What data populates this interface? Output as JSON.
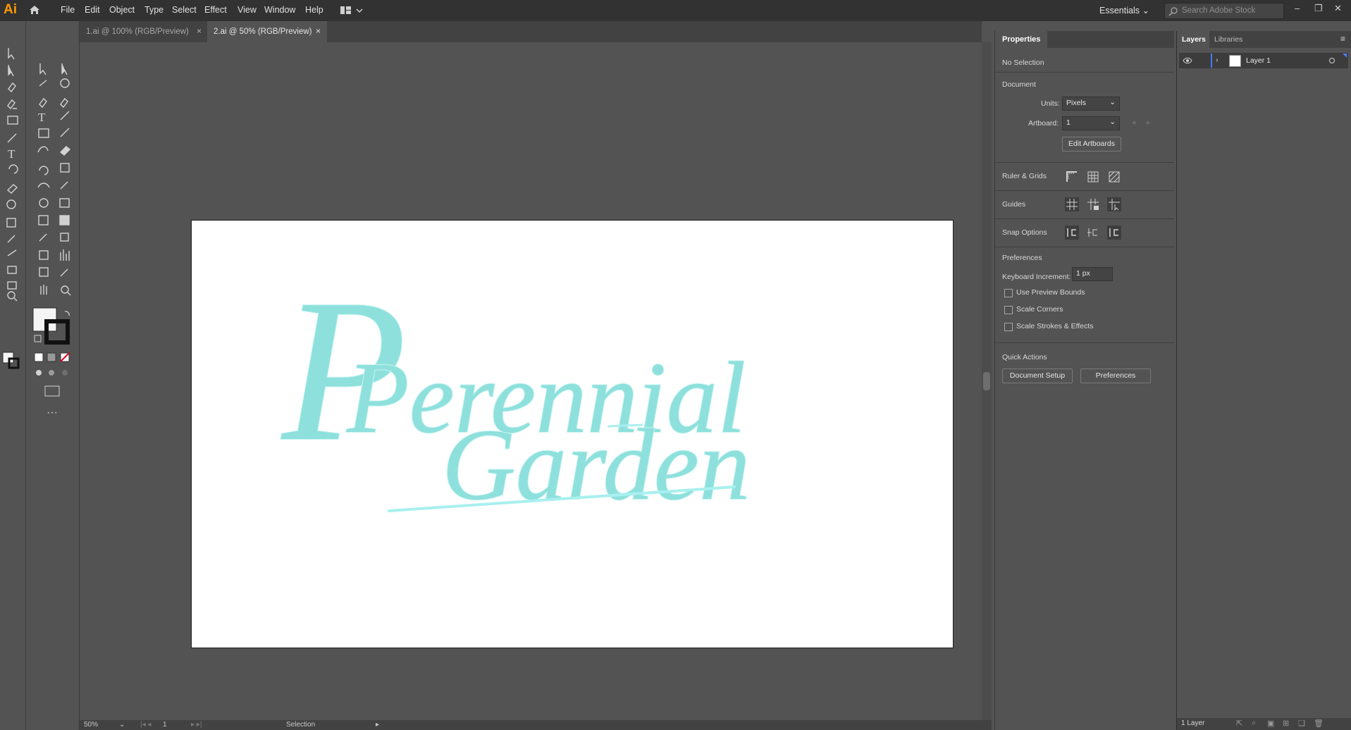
{
  "app": {
    "logo": "Ai"
  },
  "menu": [
    "File",
    "Edit",
    "Object",
    "Type",
    "Select",
    "Effect",
    "View",
    "Window",
    "Help"
  ],
  "workspace": {
    "label": "Essentials"
  },
  "search": {
    "placeholder": "Search Adobe Stock"
  },
  "tabs": [
    {
      "label": "1.ai @ 100% (RGB/Preview)",
      "close": "×",
      "active": false
    },
    {
      "label": "2.ai @ 50% (RGB/Preview)",
      "close": "×",
      "active": true
    }
  ],
  "artwork": {
    "line1": "Perennial",
    "line2": "Garden",
    "color": "#8ee0dc"
  },
  "status": {
    "zoom": "50%",
    "artboard": "1",
    "tool": "Selection"
  },
  "properties": {
    "tab": "Properties",
    "selection": "No Selection",
    "document_title": "Document",
    "units_label": "Units:",
    "units_value": "Pixels",
    "artboard_label": "Artboard:",
    "artboard_value": "1",
    "edit_artboards": "Edit Artboards",
    "rulers_label": "Ruler & Grids",
    "guides_label": "Guides",
    "snap_label": "Snap Options",
    "prefs_title": "Preferences",
    "keyboard_label": "Keyboard Increment:",
    "keyboard_value": "1 px",
    "checks": [
      "Use Preview Bounds",
      "Scale Corners",
      "Scale Strokes & Effects"
    ],
    "quick_actions_title": "Quick Actions",
    "document_setup": "Document Setup",
    "preferences_button": "Preferences"
  },
  "layers": {
    "tabs": [
      "Layers",
      "Libraries"
    ],
    "items": [
      {
        "name": "Layer 1"
      }
    ],
    "count": "1 Layer"
  },
  "colors": {
    "accent": "#ff9a00",
    "layer_color": "#4b7bff"
  }
}
